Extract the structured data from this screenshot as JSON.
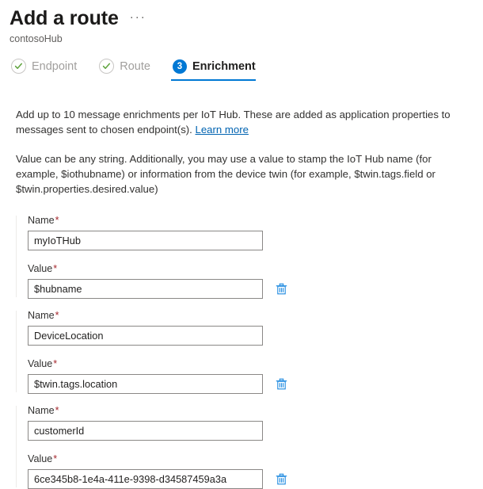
{
  "header": {
    "title": "Add a route",
    "more_menu": "···",
    "subtitle": "contosoHub"
  },
  "wizard": {
    "steps": [
      {
        "label": "Endpoint",
        "state": "completed",
        "badge": "check"
      },
      {
        "label": "Route",
        "state": "completed",
        "badge": "check"
      },
      {
        "label": "Enrichment",
        "state": "active",
        "badge": "3"
      }
    ]
  },
  "descriptions": {
    "line1_part1": "Add up to 10 message enrichments per IoT Hub. These are added as application properties to messages sent to chosen endpoint(s). ",
    "learn_more": "Learn more",
    "line2": "Value can be any string. Additionally, you may use a value to stamp the IoT Hub name (for example, $iothubname) or information from the device twin (for example, $twin.tags.field or $twin.properties.desired.value)"
  },
  "labels": {
    "name": "Name",
    "value": "Value",
    "required_marker": "*",
    "delete_icon": "trash-icon"
  },
  "enrichments": [
    {
      "name": "myIoTHub",
      "value": "$hubname"
    },
    {
      "name": "DeviceLocation",
      "value": "$twin.tags.location"
    },
    {
      "name": "customerId",
      "value": "6ce345b8-1e4a-411e-9398-d34587459a3a"
    }
  ],
  "colors": {
    "accent": "#0078d4",
    "link": "#0063b1",
    "required": "#a4262c",
    "check": "#5ea33c",
    "disabled_text": "#a19f9d",
    "input_border": "#8a8886",
    "divider": "#edebe9"
  }
}
